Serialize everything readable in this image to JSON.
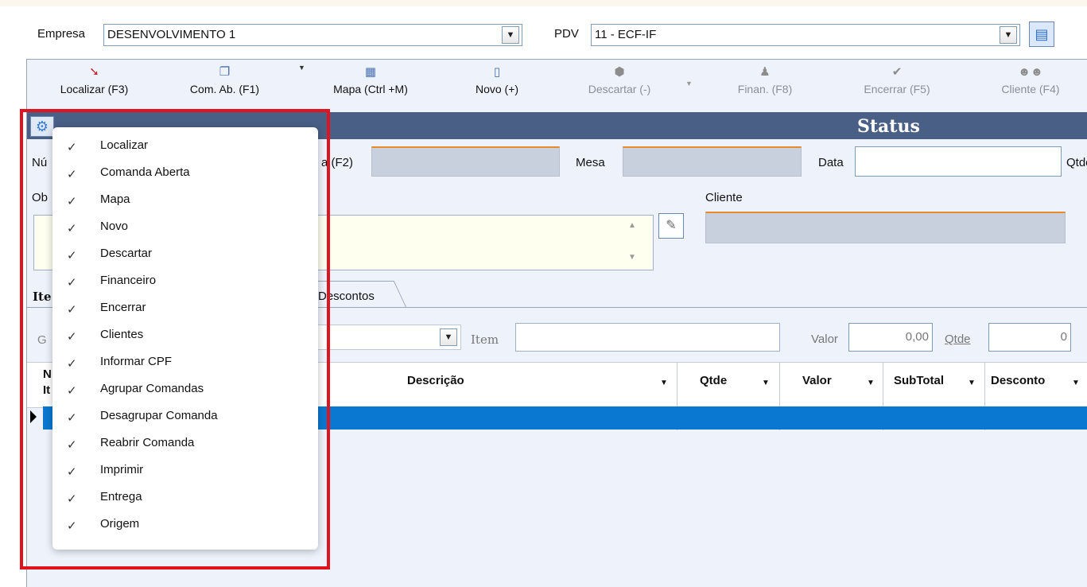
{
  "header": {
    "empresa_label": "Empresa",
    "empresa_value": "DESENVOLVIMENTO 1",
    "pdv_label": "PDV",
    "pdv_value": "11 - ECF-IF"
  },
  "toolbar": [
    {
      "label": "Localizar (F3)",
      "icon": "flashlight-icon",
      "enabled": true
    },
    {
      "label": "Com. Ab. (F1)",
      "icon": "copy-icon",
      "enabled": true
    },
    {
      "label": "Mapa (Ctrl +M)",
      "icon": "calendar-grid-icon",
      "enabled": true
    },
    {
      "label": "Novo (+)",
      "icon": "new-document-icon",
      "enabled": true
    },
    {
      "label": "Descartar (-)",
      "icon": "discard-icon",
      "enabled": false
    },
    {
      "label": "Finan. (F8)",
      "icon": "money-bag-icon",
      "enabled": false
    },
    {
      "label": "Encerrar (F5)",
      "icon": "checkmark-icon",
      "enabled": false
    },
    {
      "label": "Cliente (F4)",
      "icon": "users-icon",
      "enabled": false
    }
  ],
  "status_title": "Status",
  "form": {
    "numero_prefix": "Nú",
    "comanda_partial": "a (F2)",
    "mesa_label": "Mesa",
    "data_label": "Data",
    "qtde_partial": "Qtde",
    "obs_prefix": "Ob",
    "cliente_label": "Cliente"
  },
  "tabs": {
    "itens_partial": "Ite",
    "descontos": "Descontos"
  },
  "item_row": {
    "group_partial": "G",
    "item_label": "Item",
    "valor_label": "Valor",
    "valor_value": "0,00",
    "qtde_label": "Qtde",
    "qtde_value": "0"
  },
  "grid": {
    "first_col_line1": "N",
    "first_col_line2": "It",
    "columns": [
      "Descrição",
      "Qtde",
      "Valor",
      "SubTotal",
      "Desconto"
    ]
  },
  "menu": {
    "items": [
      {
        "label": "Localizar",
        "checked": true
      },
      {
        "label": "Comanda Aberta",
        "checked": true
      },
      {
        "label": "Mapa",
        "checked": true
      },
      {
        "label": "Novo",
        "checked": true
      },
      {
        "label": "Descartar",
        "checked": true
      },
      {
        "label": "Financeiro",
        "checked": true
      },
      {
        "label": "Encerrar",
        "checked": true
      },
      {
        "label": "Clientes",
        "checked": true
      },
      {
        "label": "Informar CPF",
        "checked": true
      },
      {
        "label": "Agrupar Comandas",
        "checked": true
      },
      {
        "label": "Desagrupar Comanda",
        "checked": true
      },
      {
        "label": "Reabrir Comanda",
        "checked": true
      },
      {
        "label": "Imprimir",
        "checked": true
      },
      {
        "label": "Entrega",
        "checked": true
      },
      {
        "label": "Origem",
        "checked": true
      }
    ],
    "check_glyph": "✓"
  },
  "colors": {
    "status_bar": "#4a5f86",
    "selected_row": "#0a78d1",
    "highlight": "#e0141e",
    "accent_orange": "#e8892b"
  }
}
